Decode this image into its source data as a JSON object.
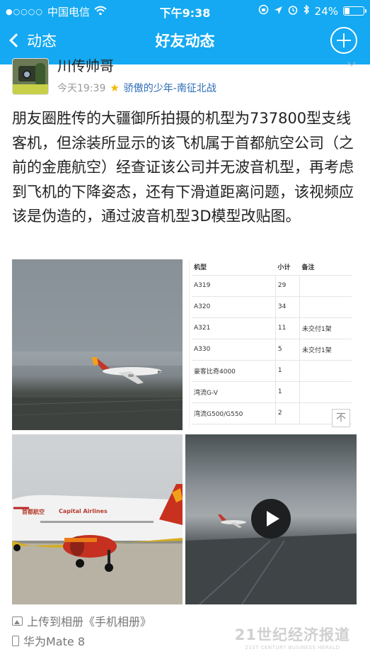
{
  "status_bar": {
    "carrier": "中国电信",
    "time": "下午9:38",
    "battery": "24%",
    "battery_level": 0.24
  },
  "nav": {
    "back_label": "动态",
    "title": "好友动态"
  },
  "post": {
    "author": "川传帅哥",
    "time": "今天19:39",
    "group": "骄傲的少年-南征北战",
    "text": "朋友圈胜传的大疆御所拍摄的机型为737800型支线客机，但涂装所显示的该飞机属于首都航空公司（之前的金鹿航空）经查证该公司并无波音机型，再考虑到飞机的下降姿态，还有下滑道距离问题，该视频应该是伪造的，通过波音机型3D模型改贴图。",
    "uploaded_to": "上传到相册《手机相册》",
    "device": "华为Mate 8"
  },
  "fleet_table": {
    "headers": [
      "机型",
      "小计",
      "备注"
    ],
    "rows": [
      [
        "A319",
        "29",
        ""
      ],
      [
        "A320",
        "34",
        ""
      ],
      [
        "A321",
        "11",
        "未交付1架"
      ],
      [
        "A330",
        "5",
        "未交付1架"
      ],
      [
        "豪客比奇4000",
        "1",
        ""
      ],
      [
        "湾流G-V",
        "1",
        ""
      ],
      [
        "湾流G500/G550",
        "2",
        ""
      ]
    ],
    "to_top": "不"
  },
  "image_text": {
    "airline_cn": "首都航空",
    "airline_en": "Capital Airlines"
  },
  "watermark": {
    "line1": "21世纪经济报道",
    "line2": "21ST CENTURY BUSINESS HERALD"
  },
  "colors": {
    "brand_blue": "#14a9f2",
    "link_blue": "#2c6cb8",
    "star_gold": "#f5b800"
  }
}
